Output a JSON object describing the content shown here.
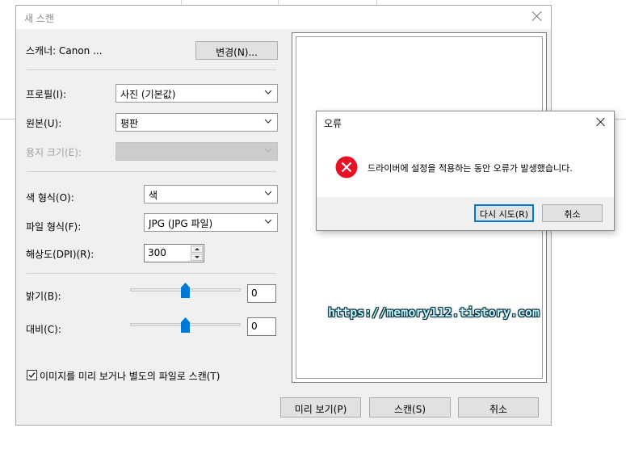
{
  "scan_dialog": {
    "title": "새 스캔",
    "scanner_label": "스캐너: Canon ...",
    "change_button": "변경(N)...",
    "profile_label": "프로필(I):",
    "profile_value": "사진 (기본값)",
    "source_label": "원본(U):",
    "source_value": "평판",
    "paper_size_label": "용지 크기(E):",
    "color_format_label": "색 형식(O):",
    "color_format_value": "색",
    "file_type_label": "파일 형식(F):",
    "file_type_value": "JPG (JPG 파일)",
    "resolution_label": "해상도(DPI)(R):",
    "resolution_value": "300",
    "brightness_label": "밝기(B):",
    "brightness_value": "0",
    "contrast_label": "대비(C):",
    "contrast_value": "0",
    "preview_checkbox_label": "이미지를 미리 보거나 별도의 파일로 스캔(T)",
    "preview_checkbox_checked": true,
    "preview_button": "미리 보기(P)",
    "scan_button": "스캔(S)",
    "cancel_button": "취소"
  },
  "watermark": "https://memory112.tistory.com",
  "error_dialog": {
    "title": "오류",
    "message": "드라이버에 설정을 적용하는 동안 오류가 발생했습니다.",
    "retry_button": "다시 시도(R)",
    "cancel_button": "취소"
  },
  "colors": {
    "dialog_bg": "#f0f0f0",
    "error_icon": "#e81123",
    "slider_thumb": "#0078d7",
    "default_button_border": "#0078d7"
  },
  "icons": {
    "error": "error-circle-x-icon",
    "close": "close-icon",
    "dropdown": "chevron-down-icon"
  }
}
